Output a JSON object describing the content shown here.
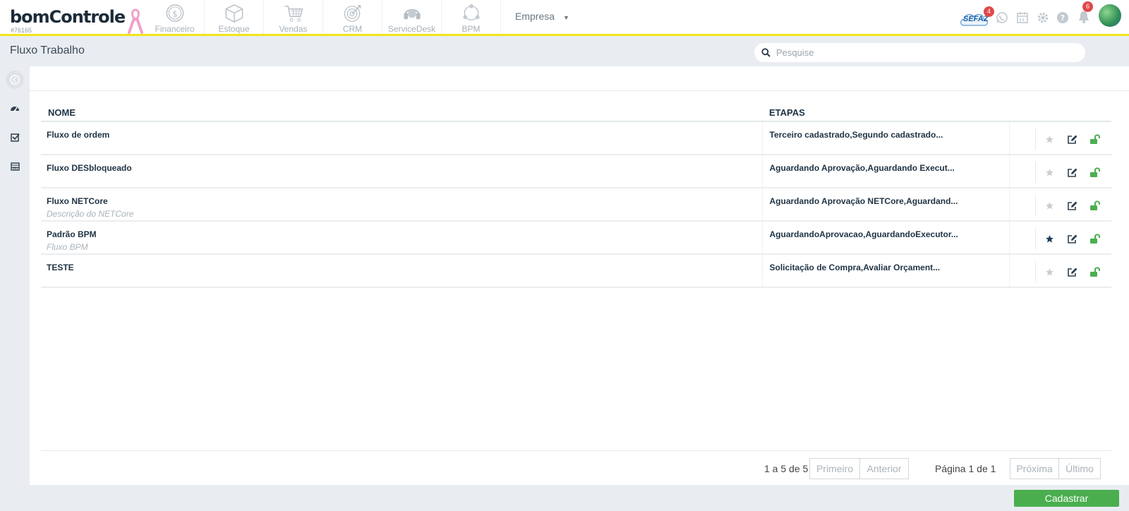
{
  "brand": {
    "logo": "bomControle",
    "account_id": "#76165"
  },
  "modules": [
    {
      "label": "Financeiro",
      "icon": "dollar-coin-icon"
    },
    {
      "label": "Estoque",
      "icon": "box-icon"
    },
    {
      "label": "Vendas",
      "icon": "cart-icon"
    },
    {
      "label": "CRM",
      "icon": "target-icon"
    },
    {
      "label": "ServiceDesk",
      "icon": "headset-icon"
    },
    {
      "label": "BPM",
      "icon": "network-icon"
    }
  ],
  "company_menu": {
    "label": "Empresa"
  },
  "topbar": {
    "sefaz_label": "SEFAZ",
    "sefaz_badge": "4",
    "notifications_badge": "6"
  },
  "page": {
    "title": "Fluxo Trabalho"
  },
  "search": {
    "placeholder": "Pesquise"
  },
  "table": {
    "headers": {
      "nome": "NOME",
      "etapas": "ETAPAS"
    },
    "rows": [
      {
        "nome": "Fluxo de ordem",
        "descricao": "",
        "etapas": "Terceiro cadastrado,Segundo cadastrado...",
        "favorito": false
      },
      {
        "nome": "Fluxo DESbloqueado",
        "descricao": "",
        "etapas": "Aguardando Aprovação,Aguardando Execut...",
        "favorito": false
      },
      {
        "nome": "Fluxo NETCore",
        "descricao": "Descrição do NETCore",
        "etapas": "Aguardando Aprovação NETCore,Aguardand...",
        "favorito": false
      },
      {
        "nome": "Padrão BPM",
        "descricao": "Fluxo BPM",
        "etapas": "AguardandoAprovacao,AguardandoExecutor...",
        "favorito": true
      },
      {
        "nome": "TESTE",
        "descricao": "",
        "etapas": "Solicitação de Compra,Avaliar Orçament...",
        "favorito": false
      }
    ]
  },
  "pagination": {
    "count": "1 a 5 de 5",
    "first": "Primeiro",
    "prev": "Anterior",
    "page_label": "Página",
    "page_current": "1",
    "page_of": "de",
    "page_total": "1",
    "next": "Próxima",
    "last": "Último"
  },
  "actions": {
    "register": "Cadastrar"
  },
  "colors": {
    "accent_yellow": "#f1e51a",
    "green": "#4aae4f",
    "badge_red": "#e04848",
    "star_active": "#1f3d5a",
    "star_inactive": "#c9ced3"
  }
}
